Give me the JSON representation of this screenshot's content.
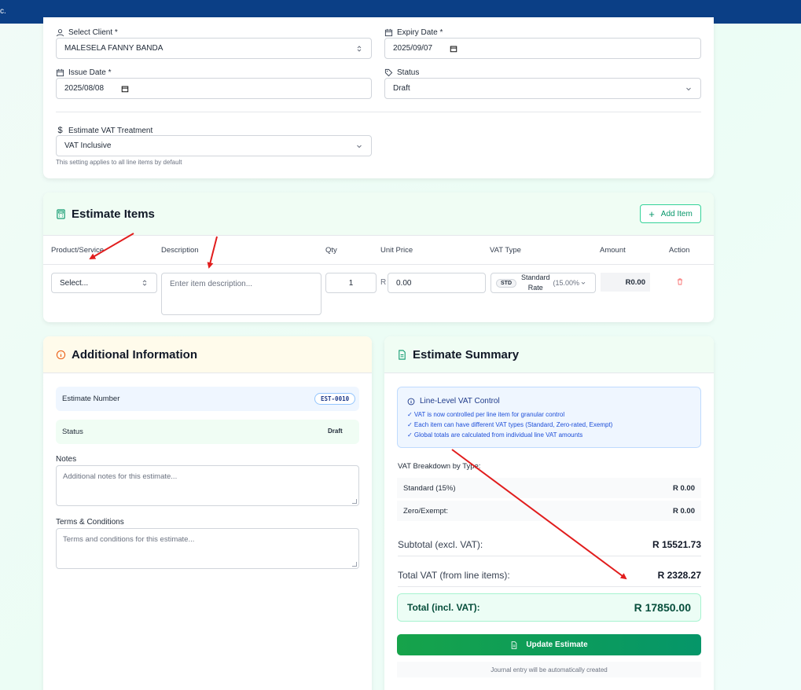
{
  "topbar": {
    "mark": "c."
  },
  "form": {
    "client_label": "Select Client *",
    "client_value": "MALESELA FANNY BANDA",
    "expiry_label": "Expiry Date *",
    "expiry_value": "2025/09/07",
    "issue_label": "Issue Date *",
    "issue_value": "2025/08/08",
    "status_label": "Status",
    "status_value": "Draft",
    "vat_label": "Estimate VAT Treatment",
    "vat_value": "VAT Inclusive",
    "vat_hint": "This setting applies to all line items by default"
  },
  "items": {
    "title": "Estimate Items",
    "add_label": "Add Item",
    "headers": {
      "product": "Product/Service",
      "description": "Description",
      "qty": "Qty",
      "unit_price": "Unit Price",
      "vat_type": "VAT Type",
      "amount": "Amount",
      "action": "Action"
    },
    "row": {
      "product": "Select...",
      "description_placeholder": "Enter item description...",
      "qty": "1",
      "currency": "R",
      "unit_price": "0.00",
      "vat_badge": "STD",
      "vat_name_1": "Standard",
      "vat_name_2": "Rate",
      "vat_rate": "(15.00%",
      "amount": "R0.00"
    }
  },
  "additional": {
    "title": "Additional Information",
    "estimate_number_label": "Estimate Number",
    "estimate_number": "EST-0010",
    "status_label": "Status",
    "status": "Draft",
    "notes_label": "Notes",
    "notes_placeholder": "Additional notes for this estimate...",
    "terms_label": "Terms & Conditions",
    "terms_placeholder": "Terms and conditions for this estimate..."
  },
  "summary": {
    "title": "Estimate Summary",
    "vat_control_title": "Line-Level VAT Control",
    "vat_control_lines": [
      "✓ VAT is now controlled per line item for granular control",
      "✓ Each item can have different VAT types (Standard, Zero-rated, Exempt)",
      "✓ Global totals are calculated from individual line VAT amounts"
    ],
    "breakdown_title": "VAT Breakdown by Type:",
    "standard_label": "Standard (15%)",
    "standard_value": "R 0.00",
    "zero_label": "Zero/Exempt:",
    "zero_value": "R 0.00",
    "subtotal_label": "Subtotal (excl. VAT):",
    "subtotal_value": "R 15521.73",
    "total_vat_label": "Total VAT (from line items):",
    "total_vat_value": "R 2328.27",
    "total_label": "Total (incl. VAT):",
    "total_value": "R 17850.00",
    "update_label": "Update Estimate",
    "journal_note": "Journal entry will be automatically created"
  },
  "colors": {
    "topbar": "#0b3f86",
    "accent_green": "#059669",
    "annotation_red": "#e11d1d"
  }
}
